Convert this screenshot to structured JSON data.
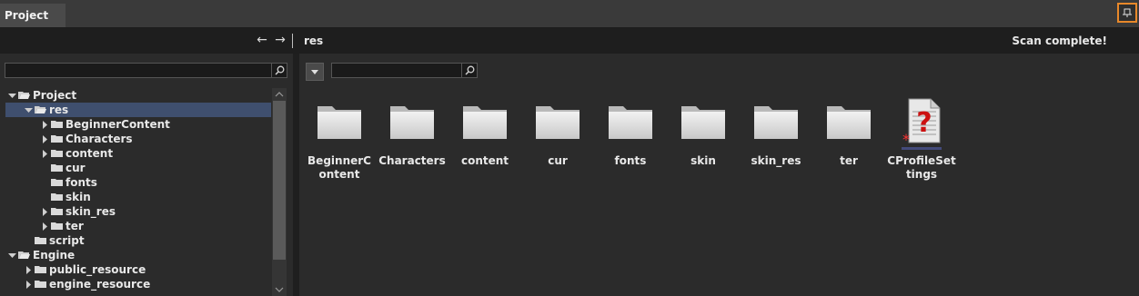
{
  "panel": {
    "tab_label": "Project"
  },
  "nav": {
    "back_symbol": "←",
    "forward_symbol": "→",
    "current_path": "res",
    "status": "Scan complete!"
  },
  "tree": {
    "rows": [
      {
        "label": "Project",
        "expanded": true
      },
      {
        "label": "res",
        "expanded": true,
        "selected": true
      },
      {
        "label": "BeginnerContent",
        "expanded": false
      },
      {
        "label": "Characters",
        "expanded": false
      },
      {
        "label": "content",
        "expanded": false
      },
      {
        "label": "cur"
      },
      {
        "label": "fonts"
      },
      {
        "label": "skin"
      },
      {
        "label": "skin_res",
        "expanded": false
      },
      {
        "label": "ter",
        "expanded": false
      },
      {
        "label": "script"
      },
      {
        "label": "Engine",
        "expanded": true
      },
      {
        "label": "public_resource",
        "expanded": false
      },
      {
        "label": "engine_resource",
        "expanded": false
      }
    ]
  },
  "grid": {
    "items": [
      {
        "label": "BeginnerContent",
        "type": "folder"
      },
      {
        "label": "Characters",
        "type": "folder"
      },
      {
        "label": "content",
        "type": "folder"
      },
      {
        "label": "cur",
        "type": "folder"
      },
      {
        "label": "fonts",
        "type": "folder"
      },
      {
        "label": "skin",
        "type": "folder"
      },
      {
        "label": "skin_res",
        "type": "folder"
      },
      {
        "label": "ter",
        "type": "folder"
      },
      {
        "label": "CProfileSettings",
        "type": "unknown-file"
      }
    ]
  },
  "colors": {
    "accent_pin": "#e8882a",
    "selection": "#3f4f6e"
  }
}
